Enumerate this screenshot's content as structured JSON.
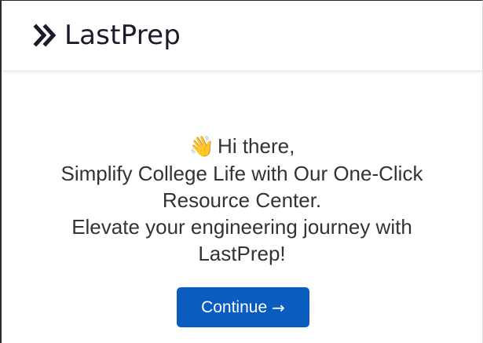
{
  "brand": {
    "name": "LastPrep",
    "icon": "double-chevron-right-icon",
    "color": "#1b1b2b"
  },
  "hero": {
    "wave_icon": "👋",
    "greeting": "Hi there,",
    "line1": "Simplify College Life with Our One-Click",
    "line2": "Resource Center.",
    "line3": "Elevate your engineering journey with",
    "line4": "LastPrep!"
  },
  "cta": {
    "label": "Continue",
    "arrow": "→",
    "color": "#0b5cbf"
  }
}
